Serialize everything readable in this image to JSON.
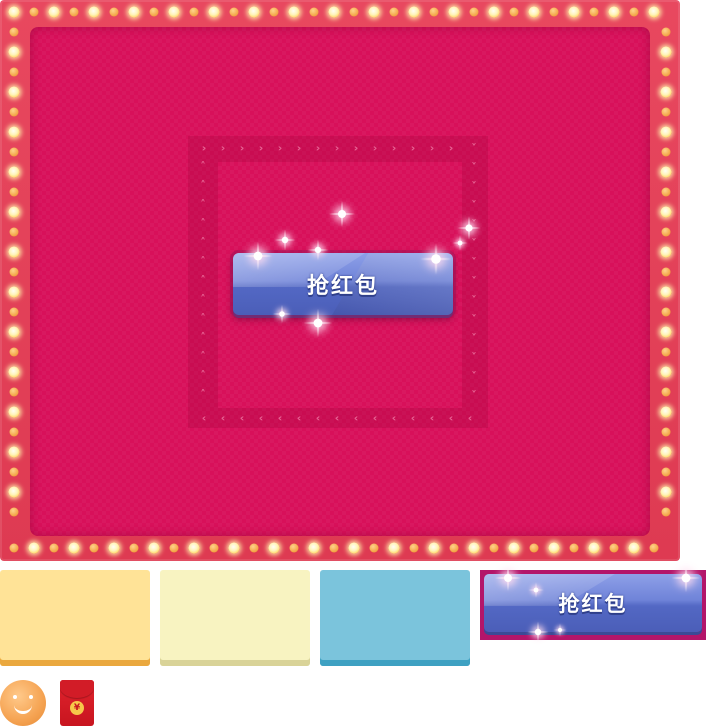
{
  "button": {
    "label": "抢红包"
  },
  "sprite_button": {
    "label": "抢红包"
  },
  "icons": {
    "bulb": "marquee-bulb-icon",
    "arrow_right": "›",
    "arrow_left": "‹",
    "arrow_up": "˄",
    "arrow_down": "˅",
    "smiley": "smiley-face-icon",
    "red_packet": "red-envelope-icon",
    "red_packet_symbol": "¥"
  },
  "colors": {
    "marquee_frame": "#e8485f",
    "stage": "#d8105a",
    "button": "#6f83d8",
    "swatch_yellow": "#ffe397",
    "swatch_cream": "#f8f3c1",
    "swatch_blue": "#7bc4dc"
  }
}
